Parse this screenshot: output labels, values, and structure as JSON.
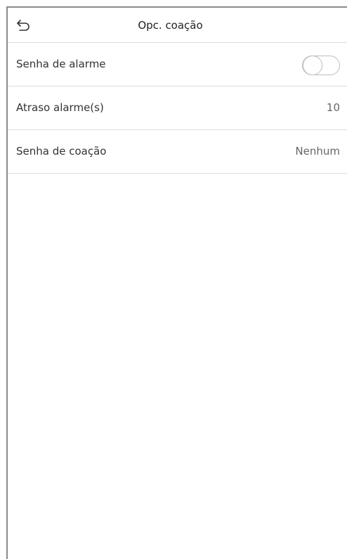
{
  "header": {
    "title": "Opc. coação",
    "back_icon": "back-arrow-icon"
  },
  "settings": {
    "alarm_password": {
      "label": "Senha de alarme",
      "enabled": false
    },
    "alarm_delay": {
      "label": "Atraso alarme(s)",
      "value": "10"
    },
    "duress_password": {
      "label": "Senha de coação",
      "value": "Nenhum"
    }
  },
  "colors": {
    "background": "#ffffff",
    "divider": "#dddddd",
    "text": "#333333",
    "value_text": "#666666"
  }
}
